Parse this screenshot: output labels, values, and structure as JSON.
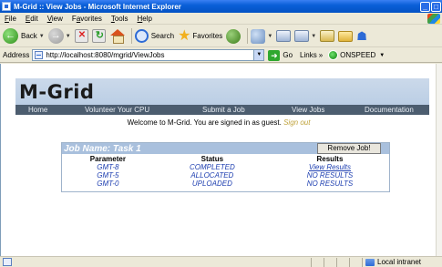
{
  "window": {
    "title": "M-Grid :: View Jobs - Microsoft Internet Explorer"
  },
  "menu": {
    "items": [
      {
        "prefix": "",
        "key": "F",
        "rest": "ile"
      },
      {
        "prefix": "",
        "key": "E",
        "rest": "dit"
      },
      {
        "prefix": "",
        "key": "V",
        "rest": "iew"
      },
      {
        "prefix": "F",
        "key": "a",
        "rest": "vorites"
      },
      {
        "prefix": "",
        "key": "T",
        "rest": "ools"
      },
      {
        "prefix": "",
        "key": "H",
        "rest": "elp"
      }
    ]
  },
  "toolbar": {
    "back_label": "Back",
    "search_label": "Search",
    "favorites_label": "Favorites"
  },
  "address": {
    "label": "Address",
    "url": "http://localhost:8080/mgrid/ViewJobs",
    "go_label": "Go",
    "links_label": "Links",
    "chevron": "»",
    "onspeed_label": "ONSPEED"
  },
  "site": {
    "logo": "M-Grid",
    "nav": [
      "Home",
      "Volunteer Your CPU",
      "Submit a Job",
      "View Jobs",
      "Documentation"
    ],
    "welcome": "Welcome to M-Grid. You are signed in as guest.",
    "signout": "Sign out"
  },
  "job": {
    "title": "Job Name: Task 1",
    "remove_label": "Remove Job!",
    "columns": [
      "Parameter",
      "Status",
      "Results"
    ],
    "rows": [
      {
        "parameter": "GMT-8",
        "status": "COMPLETED",
        "result": "View Results",
        "result_link": true
      },
      {
        "parameter": "GMT-5",
        "status": "ALLOCATED",
        "result": "NO RESULTS",
        "result_link": false
      },
      {
        "parameter": "GMT-0",
        "status": "UPLOADED",
        "result": "NO RESULTS",
        "result_link": false
      }
    ]
  },
  "status": {
    "zone": "Local intranet"
  }
}
